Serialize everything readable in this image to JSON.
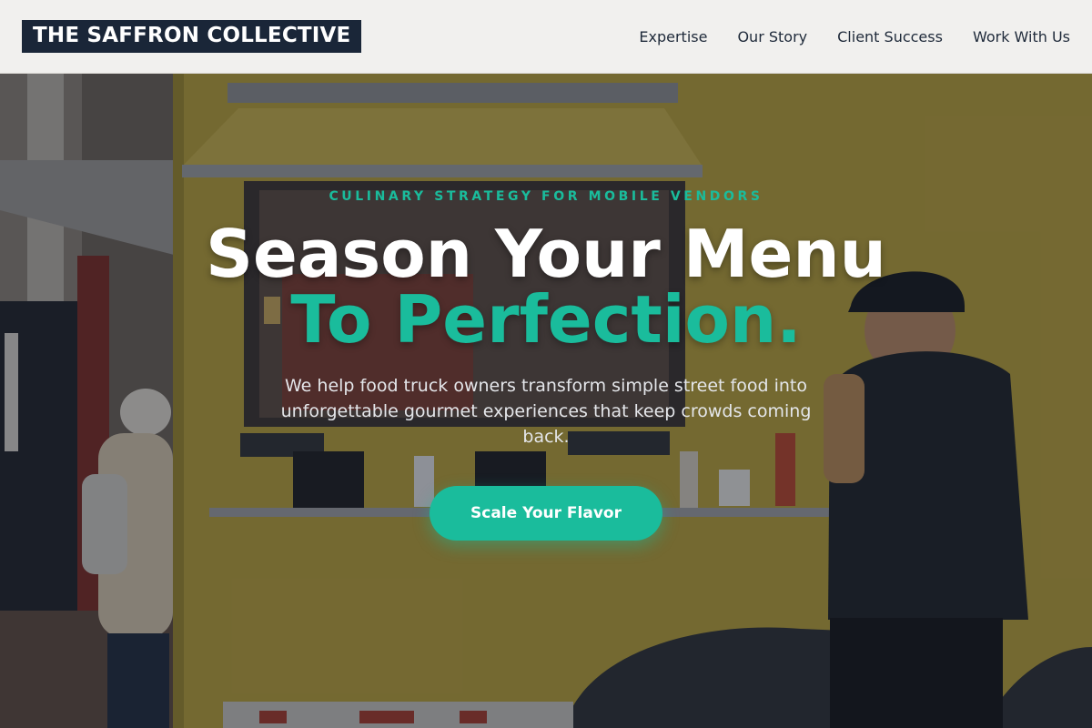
{
  "header": {
    "logo": "THE SAFFRON COLLECTIVE",
    "nav": [
      "Expertise",
      "Our Story",
      "Client Success",
      "Work With Us"
    ]
  },
  "hero": {
    "kicker": "CULINARY STRATEGY FOR MOBILE VENDORS",
    "headline_line1": "Season Your Menu",
    "headline_line2": "To Perfection.",
    "subtext": "We help food truck owners transform simple street food into unforgettable gourmet experiences that keep crowds coming back.",
    "cta_label": "Scale Your Flavor"
  },
  "colors": {
    "accent": "#1abc9c",
    "logo_bg": "#1a2638",
    "header_bg": "#f1f0ee",
    "truck_yellow": "#b9a23a"
  }
}
